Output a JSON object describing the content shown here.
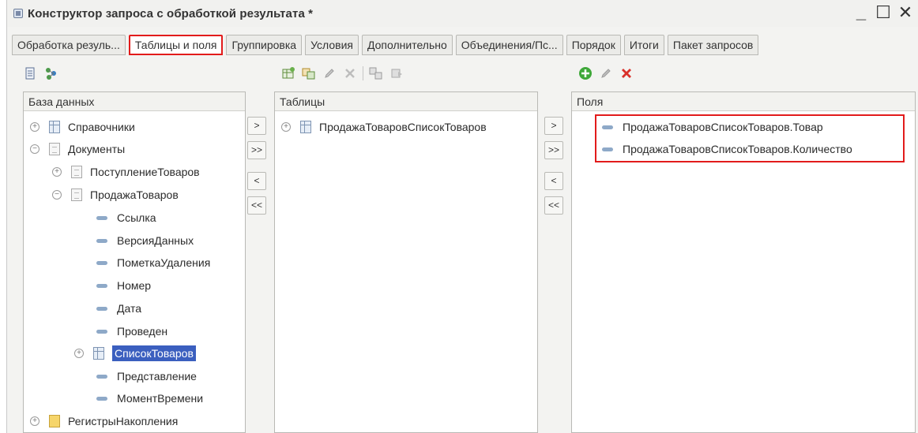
{
  "window": {
    "title": "Конструктор запроса с обработкой результата *",
    "minimize": "_",
    "maximize": "☐",
    "close": "✕"
  },
  "tabs": [
    {
      "label": "Обработка резуль...",
      "active": false
    },
    {
      "label": "Таблицы и поля",
      "active": true
    },
    {
      "label": "Группировка",
      "active": false
    },
    {
      "label": "Условия",
      "active": false
    },
    {
      "label": "Дополнительно",
      "active": false
    },
    {
      "label": "Объединения/Пс...",
      "active": false
    },
    {
      "label": "Порядок",
      "active": false
    },
    {
      "label": "Итоги",
      "active": false
    },
    {
      "label": "Пакет запросов",
      "active": false
    }
  ],
  "database_panel": {
    "header": "База данных",
    "items": [
      {
        "label": "Справочники",
        "expander": "+",
        "icon": "table-icon"
      },
      {
        "label": "Документы",
        "expander": "−",
        "icon": "document-icon"
      },
      {
        "label": "ПоступлениеТоваров",
        "expander": "+",
        "icon": "document-icon"
      },
      {
        "label": "ПродажаТоваров",
        "expander": "−",
        "icon": "document-icon"
      },
      {
        "label": "Ссылка",
        "icon": "field-icon"
      },
      {
        "label": "ВерсияДанных",
        "icon": "field-icon"
      },
      {
        "label": "ПометкаУдаления",
        "icon": "field-icon"
      },
      {
        "label": "Номер",
        "icon": "field-icon"
      },
      {
        "label": "Дата",
        "icon": "field-icon"
      },
      {
        "label": "Проведен",
        "icon": "field-icon"
      },
      {
        "label": "СписокТоваров",
        "expander": "+",
        "icon": "table-icon",
        "selected": true
      },
      {
        "label": "Представление",
        "icon": "field-icon"
      },
      {
        "label": "МоментВремени",
        "icon": "field-icon"
      },
      {
        "label": "РегистрыНакопления",
        "expander": "+",
        "icon": "register-icon"
      }
    ]
  },
  "tables_panel": {
    "header": "Таблицы",
    "items": [
      {
        "label": "ПродажаТоваровСписокТоваров",
        "expander": "+",
        "icon": "table-icon"
      }
    ]
  },
  "fields_panel": {
    "header": "Поля",
    "items": [
      {
        "label": "ПродажаТоваровСписокТоваров.Товар",
        "icon": "field-icon"
      },
      {
        "label": "ПродажаТоваровСписокТоваров.Количество",
        "icon": "field-icon"
      }
    ]
  },
  "move_buttons": {
    "add": ">",
    "add_all": ">>",
    "remove": "<",
    "remove_all": "<<"
  },
  "colors": {
    "highlight": "#e21b1b",
    "selection": "#3b5fbf",
    "add_green": "#3fa83a",
    "delete_red": "#d9302a"
  }
}
